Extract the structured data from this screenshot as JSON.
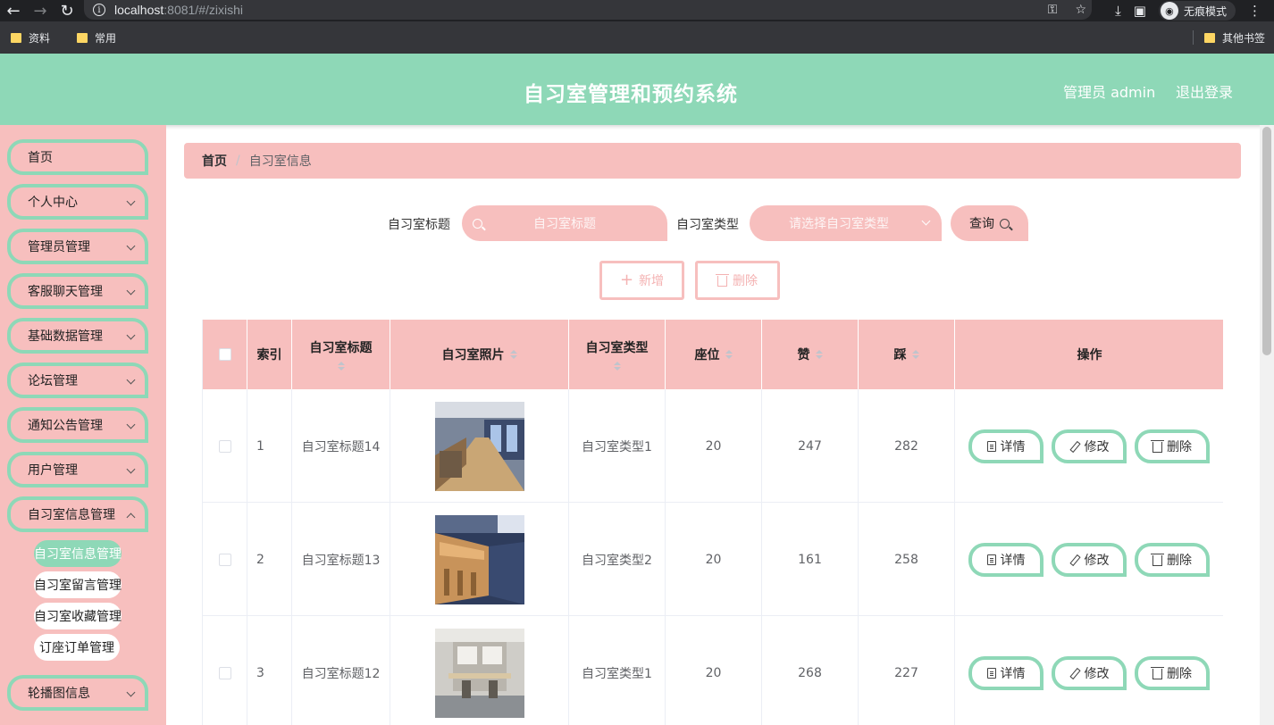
{
  "browser": {
    "url_host": "localhost",
    "url_path": ":8081/#/zixishi",
    "incognito_label": "无痕模式",
    "bookmarks": [
      "资料",
      "常用"
    ],
    "other_bookmarks": "其他书签"
  },
  "header": {
    "title": "自习室管理和预约系统",
    "user": "管理员 admin",
    "logout": "退出登录"
  },
  "sidebar": {
    "items": [
      {
        "label": "首页",
        "has_chevron": false
      },
      {
        "label": "个人中心",
        "has_chevron": true
      },
      {
        "label": "管理员管理",
        "has_chevron": true
      },
      {
        "label": "客服聊天管理",
        "has_chevron": true
      },
      {
        "label": "基础数据管理",
        "has_chevron": true
      },
      {
        "label": "论坛管理",
        "has_chevron": true
      },
      {
        "label": "通知公告管理",
        "has_chevron": true
      },
      {
        "label": "用户管理",
        "has_chevron": true
      },
      {
        "label": "自习室信息管理",
        "has_chevron": true
      },
      {
        "label": "轮播图信息",
        "has_chevron": true
      }
    ],
    "subitems": [
      {
        "label": "自习室信息管理",
        "active": true
      },
      {
        "label": "自习室留言管理",
        "active": false
      },
      {
        "label": "自习室收藏管理",
        "active": false
      },
      {
        "label": "订座订单管理",
        "active": false
      }
    ]
  },
  "breadcrumb": {
    "home": "首页",
    "separator": "/",
    "current": "自习室信息"
  },
  "search": {
    "title_label": "自习室标题",
    "title_placeholder": "自习室标题",
    "type_label": "自习室类型",
    "type_placeholder": "请选择自习室类型",
    "query_button": "查询"
  },
  "actions": {
    "add": "新增",
    "delete": "删除"
  },
  "table": {
    "columns": [
      "索引",
      "自习室标题",
      "自习室照片",
      "自习室类型",
      "座位",
      "赞",
      "踩",
      "操作"
    ],
    "rows": [
      {
        "index": "1",
        "title": "自习室标题14",
        "type": "自习室类型1",
        "seats": "20",
        "likes": "247",
        "dislikes": "282"
      },
      {
        "index": "2",
        "title": "自习室标题13",
        "type": "自习室类型2",
        "seats": "20",
        "likes": "161",
        "dislikes": "258"
      },
      {
        "index": "3",
        "title": "自习室标题12",
        "type": "自习室类型1",
        "seats": "20",
        "likes": "268",
        "dislikes": "227"
      }
    ],
    "row_actions": {
      "detail": "详情",
      "edit": "修改",
      "delete": "删除"
    }
  },
  "colors": {
    "accent_green": "#8ed8b7",
    "accent_pink": "#f7bfbe"
  }
}
